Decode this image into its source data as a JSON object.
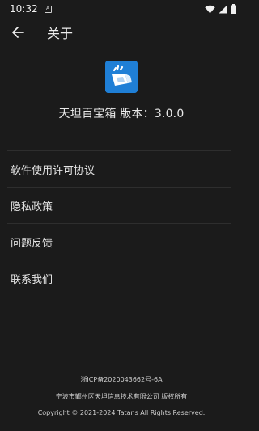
{
  "status_bar": {
    "time": "10:32",
    "notification_icon": "app-notification-icon",
    "wifi_icon": "wifi-icon",
    "signal_icon": "cell-signal-icon",
    "battery_icon": "battery-icon"
  },
  "app_bar": {
    "back_icon": "arrow-left-icon",
    "title": "关于"
  },
  "app_info": {
    "logo_icon": "toolbox-app-logo",
    "logo_color": "#1f7fd6",
    "name": "天坦百宝箱",
    "version_label": "版本：",
    "version": "3.0.0"
  },
  "menu": {
    "items": [
      {
        "label": "软件使用许可协议"
      },
      {
        "label": "隐私政策"
      },
      {
        "label": "问题反馈"
      },
      {
        "label": "联系我们"
      }
    ]
  },
  "footer": {
    "icp": "浙ICP备2020043662号-6A",
    "company": "宁波市鄞州区天坦信息技术有限公司 版权所有",
    "copyright": "Copyright © 2021-2024 Tatans All Rights Reserved."
  }
}
